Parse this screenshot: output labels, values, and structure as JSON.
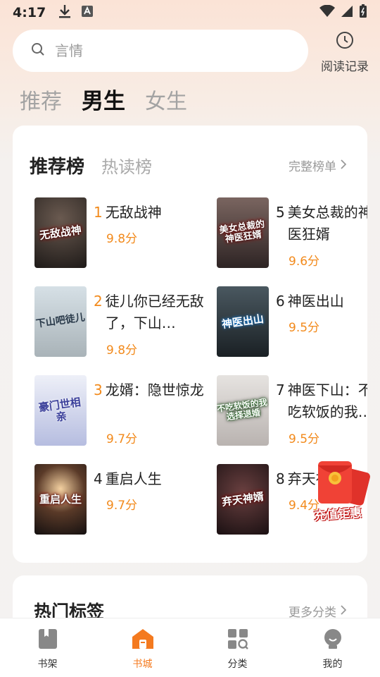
{
  "status_bar": {
    "time": "4:17"
  },
  "search": {
    "placeholder": "言情"
  },
  "history": {
    "label": "阅读记录"
  },
  "gender_tabs": [
    {
      "label": "推荐"
    },
    {
      "label": "男生"
    },
    {
      "label": "女生"
    }
  ],
  "rank": {
    "tabs": [
      {
        "label": "推荐榜"
      },
      {
        "label": "热读榜"
      }
    ],
    "full_list_label": "完整榜单",
    "books": [
      {
        "rank": "1",
        "title": "无敌战神",
        "score": "9.8分",
        "cover_text": "无敌战神",
        "cover_color": "#3a3330"
      },
      {
        "rank": "2",
        "title": "徒儿你已经无敌了，下山…",
        "score": "9.8分",
        "cover_text": "下山吧徒儿",
        "cover_color": "#c7cdd0"
      },
      {
        "rank": "3",
        "title": "龙婿：隐世惊龙",
        "score": "9.7分",
        "cover_text": "豪门世相亲",
        "cover_color": "#d9dceb"
      },
      {
        "rank": "4",
        "title": "重启人生",
        "score": "9.7分",
        "cover_text": "重启人生",
        "cover_color": "#2a2220"
      },
      {
        "rank": "5",
        "title": "美女总裁的神医狂婿",
        "score": "9.6分",
        "cover_text": "美女总裁的神医狂婿",
        "cover_color": "#4a3a3a"
      },
      {
        "rank": "6",
        "title": "神医出山",
        "score": "9.5分",
        "cover_text": "神医出山",
        "cover_color": "#2c3338"
      },
      {
        "rank": "7",
        "title": "神医下山：不吃软饭的我…",
        "score": "9.5分",
        "cover_text": "不吃软饭的我选择退婚",
        "cover_color": "#cfcccc"
      },
      {
        "rank": "8",
        "title": "弃天神婿",
        "score": "9.4分",
        "cover_text": "弃天神婿",
        "cover_color": "#3a2428"
      }
    ]
  },
  "tags": {
    "title": "热门标签",
    "more_label": "更多分类"
  },
  "promo": {
    "label": "充值钜惠"
  },
  "nav": [
    {
      "label": "书架"
    },
    {
      "label": "书城"
    },
    {
      "label": "分类"
    },
    {
      "label": "我的"
    }
  ],
  "colors": {
    "accent": "#f47a1f",
    "score": "#f28a1c"
  }
}
